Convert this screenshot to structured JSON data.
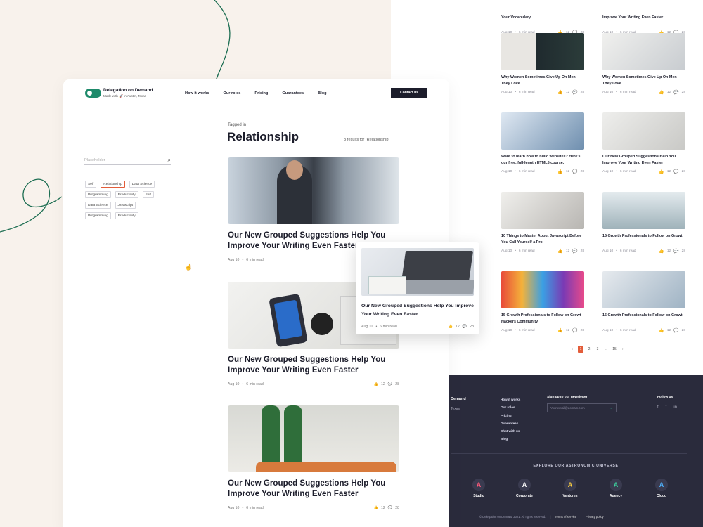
{
  "nav": {
    "brand": "Delegation on Demand",
    "tagline": "Made with 🚀 in Austin, Texas",
    "menu": [
      "How it works",
      "Our roles",
      "Pricing",
      "Guarantees",
      "Blog"
    ],
    "cta": "Contact us"
  },
  "page": {
    "tagged_in": "Tagged in",
    "title": "Relationship",
    "results": "3 results for “Relationship”"
  },
  "sidebar": {
    "search_placeholder": "Placeholder",
    "tags": [
      "Self",
      "Relationship",
      "Data Science",
      "Programming",
      "Productivity",
      "Self",
      "Data Science",
      "Javascript",
      "Programming",
      "Productivity"
    ],
    "selected_tag": "Relationship"
  },
  "posts": [
    {
      "title": "Our New Grouped Suggestions Help You Improve Your Writing Even Faster",
      "date": "Aug 10",
      "read": "6 min read",
      "likes": "12",
      "comments": "28"
    },
    {
      "title": "Our New Grouped Suggestions Help You Improve Your Writing Even Faster",
      "date": "Aug 10",
      "read": "6 min read",
      "likes": "12",
      "comments": "28"
    },
    {
      "title": "Our New Grouped Suggestions Help You Improve Your Writing Even Faster",
      "date": "Aug 10",
      "read": "6 min read",
      "likes": "12",
      "comments": "28"
    }
  ],
  "popup": {
    "title": "Our New Grouped Suggestions Help You Improve Your Writing Even Faster",
    "date": "Aug 10",
    "read": "6 min read",
    "likes": "12",
    "comments": "28"
  },
  "grid": [
    {
      "title": "Your Vocabulary",
      "date": "Aug 10",
      "read": "6 min read",
      "likes": "12",
      "comments": "28"
    },
    {
      "title": "Improve Your Writing Even Faster",
      "date": "Aug 10",
      "read": "6 min read",
      "likes": "12",
      "comments": "28"
    },
    {
      "title": "Why Women Sometimes Give Up On Men They Love",
      "date": "Aug 10",
      "read": "6 min read",
      "likes": "12",
      "comments": "28"
    },
    {
      "title": "Why Women Sometimes Give Up On Men They Love",
      "date": "Aug 10",
      "read": "6 min read",
      "likes": "12",
      "comments": "28"
    },
    {
      "title": "Want to learn how to build websites? Here's our free, full-length HTML5 course.",
      "date": "Aug 10",
      "read": "6 min read",
      "likes": "12",
      "comments": "28"
    },
    {
      "title": "Our New Grouped Suggestions Help You Improve Your Writing Even Faster",
      "date": "Aug 10",
      "read": "6 min read",
      "likes": "12",
      "comments": "28"
    },
    {
      "title": "10 Things to Master About Javascript Before You Call Yourself a Pro",
      "date": "Aug 10",
      "read": "6 min read",
      "likes": "12",
      "comments": "28"
    },
    {
      "title": "15 Growth Professionals to Follow on Growt",
      "date": "Aug 10",
      "read": "6 min read",
      "likes": "12",
      "comments": "28"
    },
    {
      "title": "15 Growth Professionals to Follow on Growt Hackers Community",
      "date": "Aug 10",
      "read": "6 min read",
      "likes": "12",
      "comments": "28"
    },
    {
      "title": "15 Growth Professionals to Follow on Growt",
      "date": "Aug 10",
      "read": "6 min read",
      "likes": "12",
      "comments": "28"
    }
  ],
  "pagination": {
    "prev": "‹",
    "pages": [
      "1",
      "2",
      "3",
      "...",
      "15"
    ],
    "current": "1",
    "next": "›"
  },
  "footer": {
    "brand": "Demand",
    "brand_sub": "Texas",
    "links": [
      "How it works",
      "Our roles",
      "Pricing",
      "Guarantees",
      "Chat with us",
      "Blog"
    ],
    "newsletter_title": "Sign up to our newsletter",
    "newsletter_placeholder": "Your.email@domain.com",
    "follow": "Follow us",
    "explore": "EXPLORE OUR ASTRONOMIC UNIVERSE",
    "brands": [
      {
        "name": "Studio",
        "color": "#ff5a7a"
      },
      {
        "name": "Corporate",
        "color": "#ffffff"
      },
      {
        "name": "Ventures",
        "color": "#ffd23f"
      },
      {
        "name": "Agency",
        "color": "#3cd6a0"
      },
      {
        "name": "Cloud",
        "color": "#4fb4ff"
      }
    ],
    "copyright": "© Delegation on Demand 2021. All rights reserved.",
    "terms": "Terms of service",
    "privacy": "Privacy policy"
  },
  "colors": {
    "accent": "#e35d3a",
    "brand_green": "#1d8a6a",
    "dark": "#1c1d2b",
    "footer_bg": "#2a2b3c"
  }
}
